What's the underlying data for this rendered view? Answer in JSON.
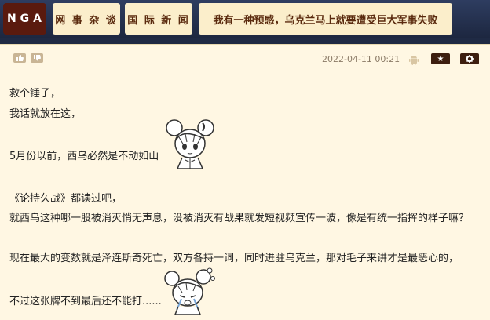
{
  "header": {
    "logo_text": "NGA",
    "breadcrumbs": [
      "网 事 杂 谈",
      "国 际 新 闻",
      "我有一种预感，乌克兰马上就要遭受巨大军事失败"
    ]
  },
  "post": {
    "date": "2022-04-11 00:21",
    "lines": [
      "救个锤子，",
      "我话就放在这，",
      "5月份以前，西乌必然是不动如山",
      "《论持久战》都读过吧，",
      "就西乌这种哪一股被消灭悄无声息，没被消灭有战果就发短视频宣传一波，像是有统一指挥的样子嘛？",
      "现在最大的变数就是泽连斯奇死亡，双方各持一词，同时进驻乌克兰，那对毛子来讲才是最恶心的，",
      "不过这张牌不到最后还不能打......"
    ]
  },
  "icons": {
    "thumb_up": "thumb-up-icon",
    "thumb_down": "thumb-down-icon",
    "android": "android-icon",
    "star": "star-icon",
    "gear": "gear-icon"
  },
  "colors": {
    "nav_bg": "#1f2a44",
    "logo_bg": "#5a1a0e",
    "crumb_bg": "#fbeecb",
    "post_bg": "#fff7e3",
    "dark_button": "#3d1e0f"
  }
}
